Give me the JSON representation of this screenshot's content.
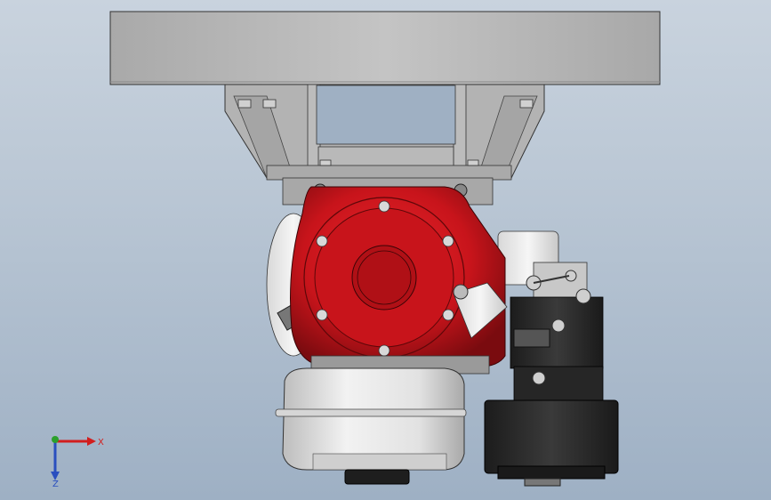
{
  "triad": {
    "x_label": "X",
    "z_label": "Z"
  },
  "colors": {
    "viewport_top": "#c9d3de",
    "viewport_bottom": "#9eb0c4",
    "gearbox_red": "#c8141b",
    "gearbox_dark_red": "#7a0b0f",
    "frame_gray": "#b8b8b8",
    "motor_black": "#2a2a2a",
    "tank_white": "#e8e8e8",
    "axis_x": "#d21e1e",
    "axis_y": "#2ca02c",
    "axis_z": "#2a4fbf"
  },
  "icons": {
    "triad": "coordinate-triad-icon"
  }
}
